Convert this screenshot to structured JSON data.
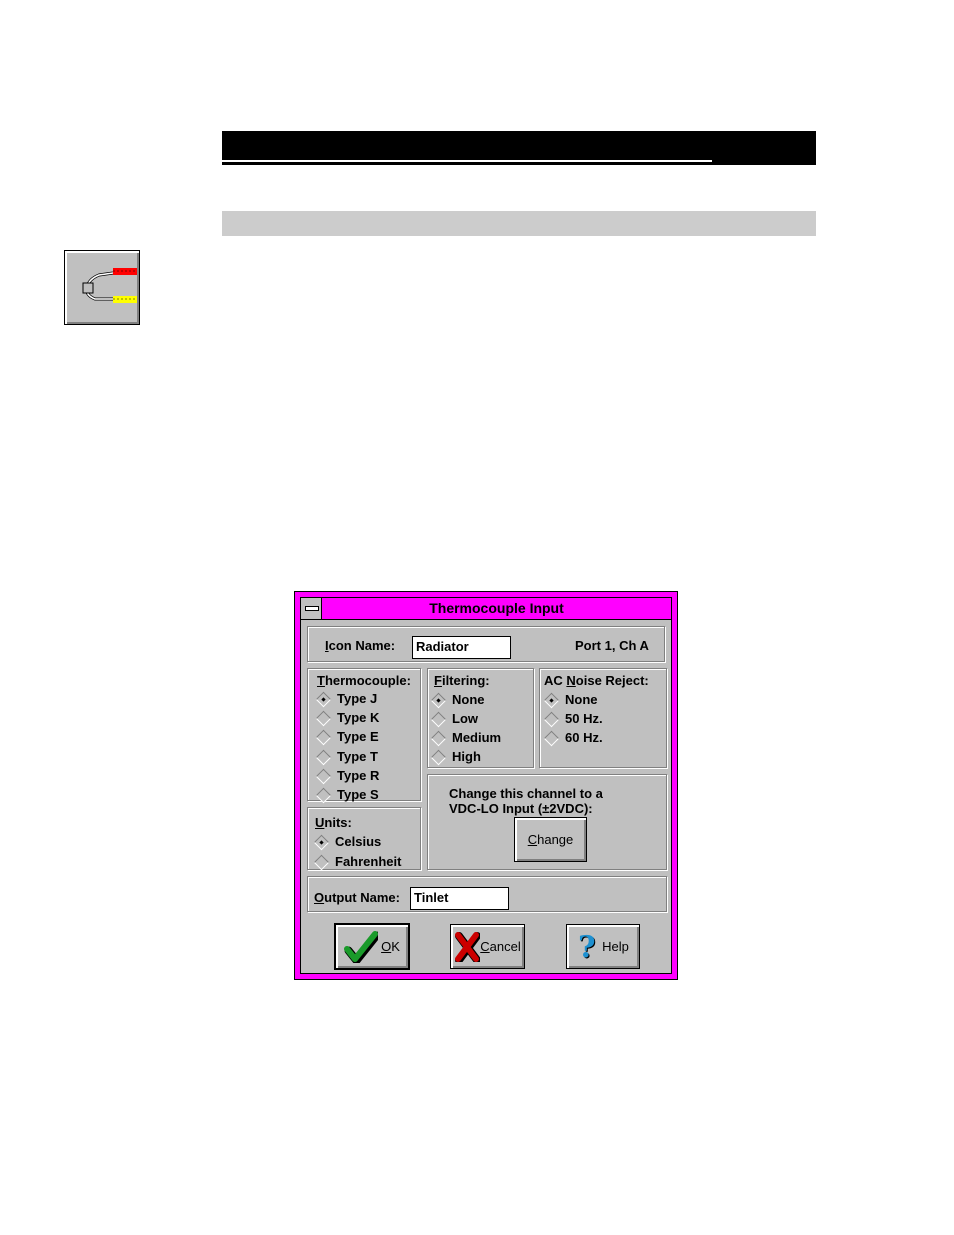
{
  "dialog": {
    "title": "Thermocouple Input",
    "icon_name": {
      "label_prefix": "I",
      "label_rest": "con Name:",
      "value": "Radiator"
    },
    "port_info": "Port 1, Ch A",
    "thermocouple": {
      "label_prefix": "T",
      "label_rest": "hermocouple:",
      "options": [
        "Type J",
        "Type K",
        "Type E",
        "Type T",
        "Type R",
        "Type S"
      ],
      "selected": "Type J"
    },
    "filtering": {
      "label_prefix": "F",
      "label_rest": "iltering:",
      "options": [
        "None",
        "Low",
        "Medium",
        "High"
      ],
      "selected": "None"
    },
    "ac_noise": {
      "label_a": "AC ",
      "label_prefix": "N",
      "label_rest": "oise Reject:",
      "options": [
        "None",
        "50 Hz.",
        "60 Hz."
      ],
      "selected": "None"
    },
    "units": {
      "label_prefix": "U",
      "label_rest": "nits:",
      "options": [
        "Celsius",
        "Fahrenheit"
      ],
      "selected": "Celsius"
    },
    "change_channel": {
      "line1": "Change this channel to a",
      "line2": "VDC-LO Input (±2VDC):",
      "button_prefix": "C",
      "button_rest": "hange"
    },
    "output_name": {
      "label_prefix": "O",
      "label_rest": "utput Name:",
      "value": "Tinlet"
    },
    "buttons": {
      "ok_prefix": "O",
      "ok_rest": "K",
      "cancel_prefix": "C",
      "cancel_rest": "ancel",
      "help_label": "Help"
    },
    "colors": {
      "title_bar": "#ff00ff",
      "face": "#c0c0c0",
      "ok_check": "#1a9a2a",
      "cancel_x": "#cc0000",
      "help_q": "#1e90d0"
    }
  }
}
